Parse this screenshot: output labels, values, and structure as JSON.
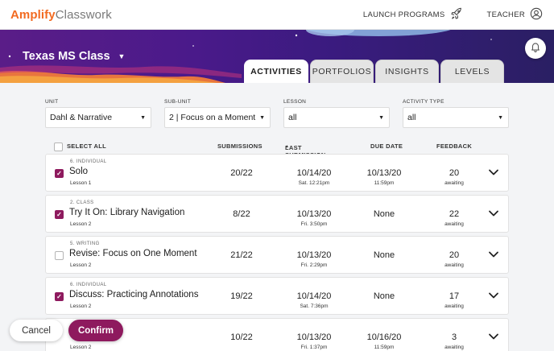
{
  "brand": {
    "name_part1": "Amplify",
    "name_part2": "Classwork",
    "brand_color": "#f26b21"
  },
  "topnav": {
    "launch_label": "LAUNCH PROGRAMS",
    "launch_icon": "rocket-icon",
    "user_label": "TEACHER",
    "user_icon": "user-circle-icon"
  },
  "hero": {
    "class_name": "Texas MS Class",
    "bell_icon": "bell-icon"
  },
  "tabs": [
    {
      "label": "ACTIVITIES",
      "active": true
    },
    {
      "label": "PORTFOLIOS",
      "active": false
    },
    {
      "label": "INSIGHTS",
      "active": false
    },
    {
      "label": "LEVELS",
      "active": false
    }
  ],
  "filters": {
    "unit": {
      "label": "UNIT",
      "value": "Dahl & Narrative"
    },
    "subunit": {
      "label": "SUB-UNIT",
      "value": "2 | Focus on a Moment"
    },
    "lesson": {
      "label": "LESSON",
      "value": "all"
    },
    "activity_type": {
      "label": "ACTIVITY TYPE",
      "value": "all"
    }
  },
  "table": {
    "select_all": "SELECT ALL",
    "col_submissions": "SUBMISSIONS",
    "col_last_submission": "LAST SUBMISSION",
    "col_last_sort_indicator": "▲",
    "col_due_date": "DUE DATE",
    "col_feedback": "FEEDBACK",
    "rows": [
      {
        "type": "6. INDIVIDUAL",
        "name": "Solo",
        "lesson": "Lesson 1",
        "checked": true,
        "submissions": "20/22",
        "last": "10/14/20",
        "last_sub": "Sat. 12:21pm",
        "due": "10/13/20",
        "due_sub": "11:59pm",
        "feedback": "20",
        "feedback_sub": "awaiting"
      },
      {
        "type": "2. CLASS",
        "name": "Try It On: Library Navigation",
        "lesson": "Lesson 2",
        "checked": true,
        "submissions": "8/22",
        "last": "10/13/20",
        "last_sub": "Fri. 3:50pm",
        "due": "None",
        "due_sub": "",
        "feedback": "22",
        "feedback_sub": "awaiting"
      },
      {
        "type": "5. WRITING",
        "name": "Revise: Focus on One Moment",
        "lesson": "Lesson 2",
        "checked": false,
        "submissions": "21/22",
        "last": "10/13/20",
        "last_sub": "Fri. 2:29pm",
        "due": "None",
        "due_sub": "",
        "feedback": "20",
        "feedback_sub": "awaiting"
      },
      {
        "type": "6. INDIVIDUAL",
        "name": "Discuss: Practicing Annotations",
        "lesson": "Lesson 2",
        "checked": true,
        "submissions": "19/22",
        "last": "10/14/20",
        "last_sub": "Sat. 7:36pm",
        "due": "None",
        "due_sub": "",
        "feedback": "17",
        "feedback_sub": "awaiting"
      },
      {
        "type": "",
        "name": "",
        "lesson": "Lesson 2",
        "checked": false,
        "submissions": "10/22",
        "last": "10/13/20",
        "last_sub": "Fri. 1:37pm",
        "due": "10/16/20",
        "due_sub": "11:59pm",
        "feedback": "3",
        "feedback_sub": "awaiting"
      }
    ]
  },
  "actions": {
    "cancel_label": "Cancel",
    "confirm_label": "Confirm",
    "confirm_color": "#8e1a5e"
  }
}
